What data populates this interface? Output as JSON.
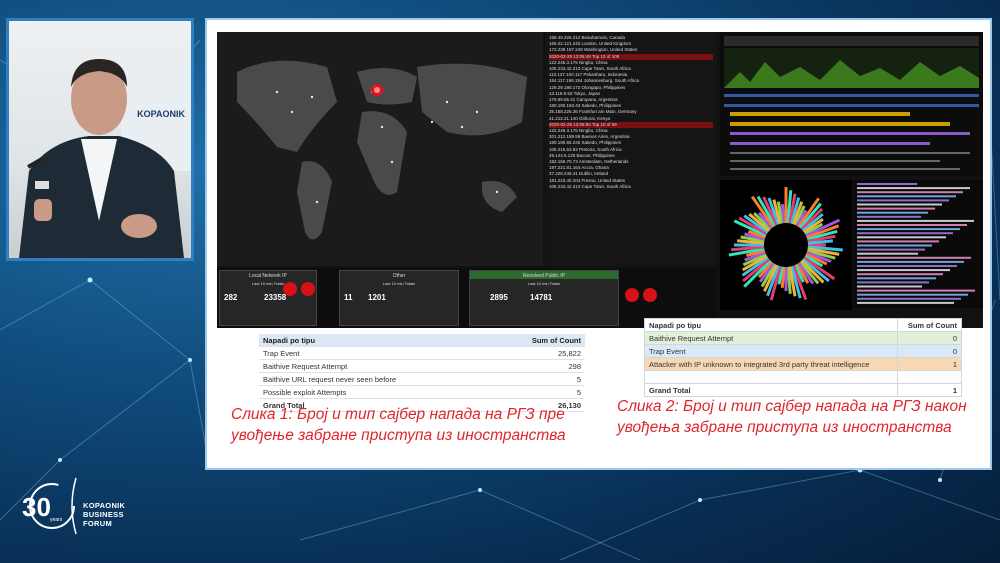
{
  "speaker": {
    "banner_text": "KOPAONIK"
  },
  "dashboard": {
    "list_rows": [
      "158.49.226.212  Beauharnois, Canada",
      "165.22.121.243  London, United Kingdom",
      "173.239.197.249  Washington, United States",
      "2020-02-29 13:06:48  Top 10 of 108",
      "122.246.3.175  Ningbo, China",
      "105.233.42.213  Cape Town, South Africa",
      "110.137.100.117  Pekanbaru, Indonesia",
      "154.117.196.154  Johannesburg, South Africa",
      "129.29.190.172  Olongapo, Philippines",
      "13.115.9.52  Tokyo, Japan",
      "179.59.55.41  Campana, Argentina",
      "180.190.193.43  Sakedo, Philippines",
      "35.158.225.36  Frankfurt am Main, Germany",
      "41.212.21.140  Githurai, Kenya",
      "2020-02-29 13:06:50  Top 10 of 99",
      "122.246.3.175  Ningbo, China",
      "201.212.189.59  Buenos Aires, Argentina",
      "180.190.65.225  Sakedo, Philippines",
      "105.215.53.93  Pretoria, South Africa",
      "49.144.5.120  Bacoor, Philippines",
      "152.166.70.73  Amsterdam, Netherlands",
      "197.221.81.164  Accra, Ghana",
      "37.228.249.41  Dublin, Ireland",
      "181.223.40.204  Fresno, United States",
      "105.233.42.213  Cape Town, South Africa"
    ],
    "panels": [
      {
        "title": "Local Network IP",
        "sub": "Last 10 min Totals",
        "count": "282",
        "events": "23358"
      },
      {
        "title": "Other",
        "sub": "Last 10 min Totals",
        "count": "11",
        "events": "1201"
      },
      {
        "title": "Resolved Public IP",
        "sub": "Last 10 min Totals",
        "count": "2895",
        "events": "14781"
      }
    ]
  },
  "table1": {
    "header": [
      "Napadi po tipu",
      "Sum of Count"
    ],
    "rows": [
      [
        "Trap Event",
        "25,822"
      ],
      [
        "Baithive Request Attempt",
        "298"
      ],
      [
        "Baithive URL request never seen before",
        "5"
      ],
      [
        "Possible exploit Attempts",
        "5"
      ]
    ],
    "total": [
      "Grand Total",
      "26,130"
    ]
  },
  "table2": {
    "header": [
      "Napadi po tipu",
      "Sum of Count"
    ],
    "rows": [
      [
        "Baithive Request Attempt",
        "0"
      ],
      [
        "Trap Event",
        "0"
      ],
      [
        "Attacker with IP unknown to integrated 3rd party threat intelligence",
        "1"
      ],
      [
        "",
        ""
      ]
    ],
    "total": [
      "Grand Total",
      "1"
    ]
  },
  "captions": {
    "c1": "Слика 1: Број и тип сајбер напада на РГЗ пре увођење забране приступа из иностранства",
    "c2": "Слика 2: Број и тип сајбер напада на РГЗ након увођења забране приступа из иностранства"
  },
  "logo": {
    "number": "30",
    "years": "years",
    "line1": "KOPAONIK",
    "line2": "BUSINESS",
    "line3": "FORUM"
  },
  "colors": {
    "accent_red": "#e0252b",
    "frame_blue": "#2f7fc1"
  }
}
